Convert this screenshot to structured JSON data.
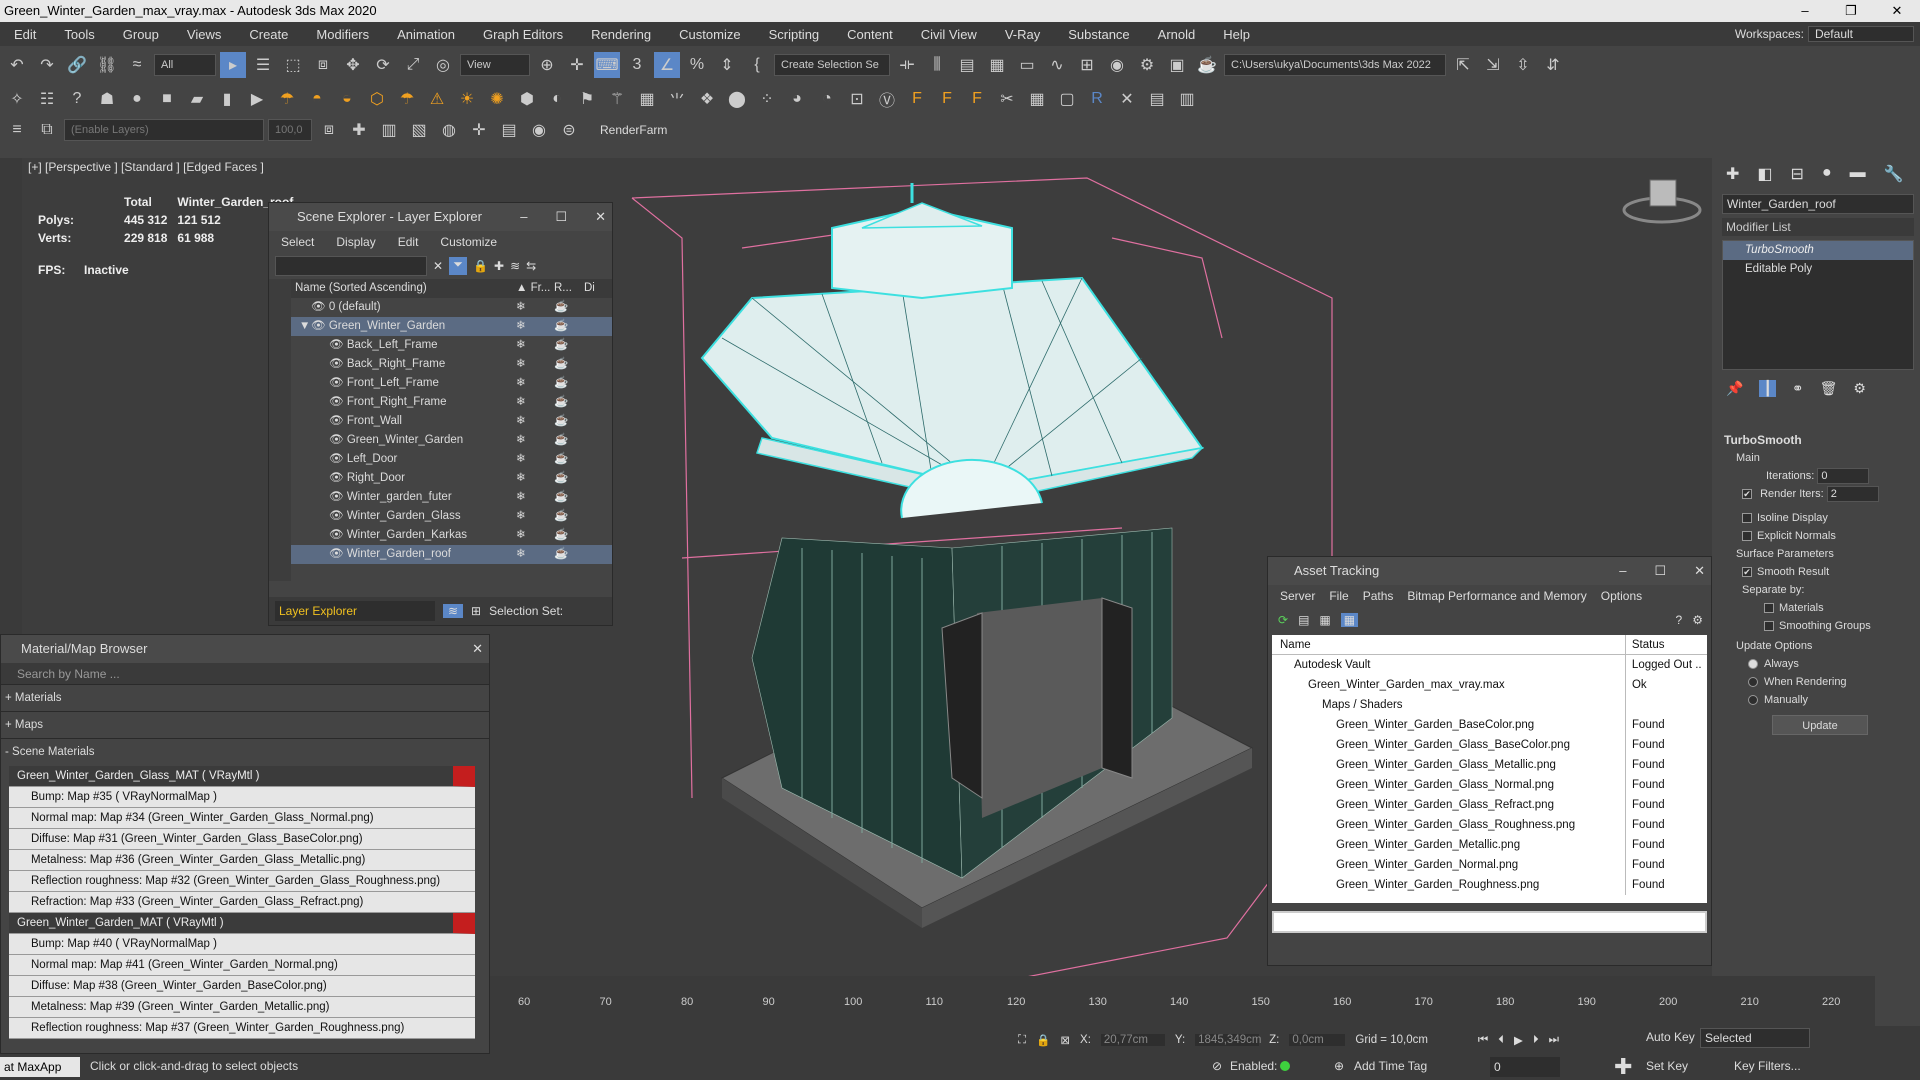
{
  "window": {
    "title": "Green_Winter_Garden_max_vray.max - Autodesk 3ds Max 2020",
    "controls": [
      "–",
      "❐",
      "✕"
    ]
  },
  "menu": [
    "Edit",
    "Tools",
    "Group",
    "Views",
    "Create",
    "Modifiers",
    "Animation",
    "Graph Editors",
    "Rendering",
    "Customize",
    "Scripting",
    "Content",
    "Civil View",
    "V-Ray",
    "Substance",
    "Arnold",
    "Help"
  ],
  "workspace": {
    "label": "Workspaces:",
    "value": "Default"
  },
  "toolbar": {
    "filter_value": "All",
    "view_value": "View",
    "selection_set_value": "Create Selection Se",
    "path_value": "C:\\Users\\ukya\\Documents\\3ds Max 2022",
    "enable_layers_placeholder": "(Enable Layers)",
    "value_100": "100,0",
    "renderfarm": "RenderFarm"
  },
  "viewport": {
    "label": "[+] [Perspective ] [Standard ] [Edged Faces ]",
    "stats": {
      "total_label": "Total",
      "object_label": "Winter_Garden_roof",
      "polys_label": "Polys:",
      "polys_total": "445 312",
      "polys_obj": "121 512",
      "verts_label": "Verts:",
      "verts_total": "229 818",
      "verts_obj": "61 988",
      "fps_label": "FPS:",
      "fps_value": "Inactive"
    }
  },
  "scene_explorer": {
    "title": "Scene Explorer - Layer Explorer",
    "menu": [
      "Select",
      "Display",
      "Edit",
      "Customize"
    ],
    "columns": {
      "name": "Name (Sorted Ascending)",
      "fr": "▲ Fr...",
      "r": "R...",
      "di": "Di"
    },
    "rows": [
      {
        "label": "0 (default)",
        "indent": 0,
        "selected": false
      },
      {
        "label": "Green_Winter_Garden",
        "indent": 0,
        "selected": true
      },
      {
        "label": "Back_Left_Frame",
        "indent": 1,
        "selected": false
      },
      {
        "label": "Back_Right_Frame",
        "indent": 1,
        "selected": false
      },
      {
        "label": "Front_Left_Frame",
        "indent": 1,
        "selected": false
      },
      {
        "label": "Front_Right_Frame",
        "indent": 1,
        "selected": false
      },
      {
        "label": "Front_Wall",
        "indent": 1,
        "selected": false
      },
      {
        "label": "Green_Winter_Garden",
        "indent": 1,
        "selected": false
      },
      {
        "label": "Left_Door",
        "indent": 1,
        "selected": false
      },
      {
        "label": "Right_Door",
        "indent": 1,
        "selected": false
      },
      {
        "label": "Winter_garden_futer",
        "indent": 1,
        "selected": false
      },
      {
        "label": "Winter_Garden_Glass",
        "indent": 1,
        "selected": false
      },
      {
        "label": "Winter_Garden_Karkas",
        "indent": 1,
        "selected": false
      },
      {
        "label": "Winter_Garden_roof",
        "indent": 1,
        "selected": true
      }
    ],
    "footer_mode": "Layer Explorer",
    "selection_set_label": "Selection Set:"
  },
  "material_browser": {
    "title": "Material/Map Browser",
    "search_placeholder": "Search by Name ...",
    "groups": [
      "+ Materials",
      "+ Maps",
      "- Scene Materials"
    ],
    "rows": [
      {
        "text": "Green_Winter_Garden_Glass_MAT  ( VRayMtl )",
        "head": true
      },
      {
        "text": "Bump: Map #35  ( VRayNormalMap )",
        "head": false
      },
      {
        "text": "Normal map: Map #34 (Green_Winter_Garden_Glass_Normal.png)",
        "head": false
      },
      {
        "text": "Diffuse: Map #31 (Green_Winter_Garden_Glass_BaseColor.png)",
        "head": false
      },
      {
        "text": "Metalness: Map #36 (Green_Winter_Garden_Glass_Metallic.png)",
        "head": false
      },
      {
        "text": "Reflection roughness: Map #32 (Green_Winter_Garden_Glass_Roughness.png)",
        "head": false
      },
      {
        "text": "Refraction: Map #33 (Green_Winter_Garden_Glass_Refract.png)",
        "head": false
      },
      {
        "text": "Green_Winter_Garden_MAT  ( VRayMtl )",
        "head": true
      },
      {
        "text": "Bump: Map #40  ( VRayNormalMap )",
        "head": false
      },
      {
        "text": "Normal map: Map #41 (Green_Winter_Garden_Normal.png)",
        "head": false
      },
      {
        "text": "Diffuse: Map #38 (Green_Winter_Garden_BaseColor.png)",
        "head": false
      },
      {
        "text": "Metalness: Map #39 (Green_Winter_Garden_Metallic.png)",
        "head": false
      },
      {
        "text": "Reflection roughness: Map #37 (Green_Winter_Garden_Roughness.png)",
        "head": false
      }
    ]
  },
  "asset_tracking": {
    "title": "Asset Tracking",
    "menu": [
      "Server",
      "File",
      "Paths",
      "Bitmap Performance and Memory",
      "Options"
    ],
    "col_name": "Name",
    "col_status": "Status",
    "rows": [
      {
        "name": "Autodesk Vault",
        "status": "Logged Out ..",
        "indent": 1
      },
      {
        "name": "Green_Winter_Garden_max_vray.max",
        "status": "Ok",
        "indent": 2
      },
      {
        "name": "Maps / Shaders",
        "status": "",
        "indent": 3
      },
      {
        "name": "Green_Winter_Garden_BaseColor.png",
        "status": "Found",
        "indent": 4
      },
      {
        "name": "Green_Winter_Garden_Glass_BaseColor.png",
        "status": "Found",
        "indent": 4
      },
      {
        "name": "Green_Winter_Garden_Glass_Metallic.png",
        "status": "Found",
        "indent": 4
      },
      {
        "name": "Green_Winter_Garden_Glass_Normal.png",
        "status": "Found",
        "indent": 4
      },
      {
        "name": "Green_Winter_Garden_Glass_Refract.png",
        "status": "Found",
        "indent": 4
      },
      {
        "name": "Green_Winter_Garden_Glass_Roughness.png",
        "status": "Found",
        "indent": 4
      },
      {
        "name": "Green_Winter_Garden_Metallic.png",
        "status": "Found",
        "indent": 4
      },
      {
        "name": "Green_Winter_Garden_Normal.png",
        "status": "Found",
        "indent": 4
      },
      {
        "name": "Green_Winter_Garden_Roughness.png",
        "status": "Found",
        "indent": 4
      }
    ]
  },
  "command_panel": {
    "object_name": "Winter_Garden_roof",
    "modifier_list": "Modifier List",
    "stack": [
      "TurboSmooth",
      "Editable Poly"
    ],
    "rollout_title": "TurboSmooth",
    "main_label": "Main",
    "iterations_label": "Iterations:",
    "iterations_value": "0",
    "render_iters_label": "Render Iters:",
    "render_iters_value": "2",
    "isoline_label": "Isoline Display",
    "explicit_label": "Explicit Normals",
    "surface_params": "Surface Parameters",
    "smooth_result": "Smooth Result",
    "separate_by": "Separate by:",
    "materials": "Materials",
    "smoothing_groups": "Smoothing Groups",
    "update_options": "Update Options",
    "always": "Always",
    "when_rendering": "When Rendering",
    "manually": "Manually",
    "update_btn": "Update"
  },
  "timeline": {
    "ticks": [
      "60",
      "70",
      "80",
      "90",
      "100",
      "110",
      "120",
      "130",
      "140",
      "150",
      "160",
      "170",
      "180",
      "190",
      "200",
      "210",
      "220"
    ]
  },
  "statusbar": {
    "maxapp": "at MaxApp",
    "prompt": "Click or click-and-drag to select objects",
    "x_label": "X:",
    "x_value": "20,77cm",
    "y_label": "Y:",
    "y_value": "1845,349cm",
    "z_label": "Z:",
    "z_value": "0,0cm",
    "grid": "Grid = 10,0cm",
    "enabled": "Enabled:",
    "add_time_tag": "Add Time Tag",
    "auto_key": "Auto Key",
    "set_key": "Set Key",
    "selected": "Selected",
    "key_filters": "Key Filters...",
    "frame": "0"
  }
}
